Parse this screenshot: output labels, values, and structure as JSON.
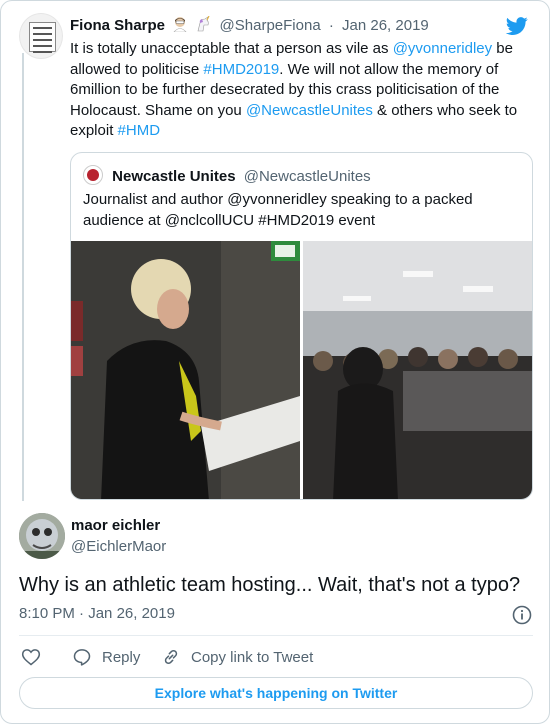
{
  "parent_tweet": {
    "name": "Fiona Sharpe",
    "emojis": [
      "woman-scientist-emoji",
      "unicorn-emoji"
    ],
    "handle": "@SharpeFiona",
    "separator": "·",
    "date": "Jan 26, 2019",
    "text_segments": [
      {
        "text": "It is totally unacceptable that a person as vile as ",
        "link": false
      },
      {
        "text": "@yvonneridley",
        "link": true
      },
      {
        "text": " be allowed to politicise ",
        "link": false
      },
      {
        "text": "#HMD2019",
        "link": true
      },
      {
        "text": ". We will not allow the memory of 6million to be further desecrated by this crass politicisation of the Holocaust. Shame on you ",
        "link": false
      },
      {
        "text": "@NewcastleUnites",
        "link": true
      },
      {
        "text": " & others who seek to exploit ",
        "link": false
      },
      {
        "text": "#HMD",
        "link": true
      }
    ]
  },
  "quoted_tweet": {
    "name": "Newcastle Unites",
    "handle": "@NewcastleUnites",
    "text": "Journalist and author @yvonneridley speaking to a packed audience at @nclcollUCU #HMD2019 event"
  },
  "reply_tweet": {
    "name": "maor eichler",
    "handle": "@EichlerMaor",
    "text": "Why is an athletic team hosting... Wait, that's not a typo?",
    "time": "8:10 PM",
    "separator": "·",
    "date": "Jan 26, 2019"
  },
  "actions": {
    "reply_label": "Reply",
    "copy_label": "Copy link to Tweet"
  },
  "explore_label": "Explore what's happening on Twitter",
  "colors": {
    "link": "#1d9bf0",
    "secondary_text": "#536471",
    "border": "#cfd9de"
  }
}
